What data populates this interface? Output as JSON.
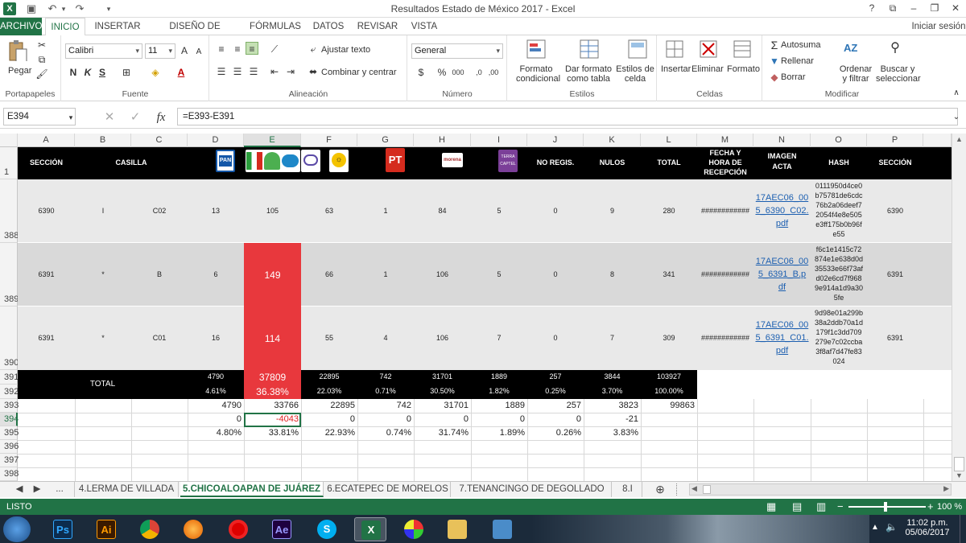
{
  "title": "Resultados Estado de México 2017 - Excel",
  "tabs": {
    "file": "ARCHIVO",
    "items": [
      "INICIO",
      "INSERTAR",
      "DISEÑO DE PÁGINA",
      "FÓRMULAS",
      "DATOS",
      "REVISAR",
      "VISTA"
    ],
    "signin": "Iniciar sesión"
  },
  "ribbon": {
    "paste": "Pegar",
    "clipboard": "Portapapeles",
    "font_name": "Calibri",
    "font_size": "11",
    "font_group": "Fuente",
    "wrap": "Ajustar texto",
    "merge": "Combinar y centrar",
    "align_group": "Alineación",
    "number_format": "General",
    "number_group": "Número",
    "cond_format": [
      "Formato",
      "condicional"
    ],
    "as_table": [
      "Dar formato",
      "como tabla"
    ],
    "cell_styles": [
      "Estilos de",
      "celda"
    ],
    "styles_group": "Estilos",
    "insert": "Insertar",
    "delete": "Eliminar",
    "format": "Formato",
    "cells_group": "Celdas",
    "autosum": "Autosuma",
    "fill": "Rellenar",
    "clear": "Borrar",
    "sort": [
      "Ordenar",
      "y filtrar"
    ],
    "find": [
      "Buscar y",
      "seleccionar"
    ],
    "modify_group": "Modificar"
  },
  "formula_bar": {
    "cell_ref": "E394",
    "fx": "fx",
    "formula": "=E393-E391"
  },
  "columns": [
    "A",
    "B",
    "C",
    "D",
    "E",
    "F",
    "G",
    "H",
    "I",
    "J",
    "K",
    "L",
    "M",
    "N",
    "O",
    "P"
  ],
  "header_row": {
    "row": "1",
    "seccion": "SECCIÓN",
    "casilla": "CASILLA",
    "no_regis": "NO REGIS.",
    "nulos": "NULOS",
    "total": "TOTAL",
    "fecha": [
      "FECHA Y",
      "HORA DE",
      "RECEPCIÓN"
    ],
    "imagen": [
      "IMAGEN",
      "ACTA"
    ],
    "hash": "HASH",
    "seccion2": "SECCIÓN",
    "logos": {
      "pan": "PAN",
      "pt": "PT",
      "morena": "morena",
      "pri": "PRI",
      "prd": "PRD",
      "terra": "TERRA CAPTEL"
    }
  },
  "rows": [
    {
      "row": "388",
      "a": "6390",
      "b": "I",
      "c": "C02",
      "d": "13",
      "e": "105",
      "f": "63",
      "g": "1",
      "h": "84",
      "i": "5",
      "j": "0",
      "k": "9",
      "l": "280",
      "m": "############",
      "n": [
        "17AEC06_00",
        "5_6390_C02.",
        "pdf"
      ],
      "o": [
        "0111950d4ce0",
        "b75781de6cdc",
        "76b2a06deef7",
        "2054f4e8e505",
        "e3ff175b0b96f",
        "e55"
      ],
      "p": "6390"
    },
    {
      "row": "389",
      "a": "6391",
      "b": "*",
      "c": "B",
      "d": "6",
      "e": "149",
      "f": "66",
      "g": "1",
      "h": "106",
      "i": "5",
      "j": "0",
      "k": "8",
      "l": "341",
      "m": "############",
      "n": [
        "17AEC06_00",
        "5_6391_B.p",
        "df"
      ],
      "o": [
        "f6c1e1415c72",
        "874e1e638d0d",
        "35533e66f73af",
        "d02e6cd7f968",
        "9e914a1d9a30",
        "5fe"
      ],
      "p": "6391"
    },
    {
      "row": "390",
      "a": "6391",
      "b": "*",
      "c": "C01",
      "d": "16",
      "e": "114",
      "f": "55",
      "g": "4",
      "h": "106",
      "i": "7",
      "j": "0",
      "k": "7",
      "l": "309",
      "m": "############",
      "n": [
        "17AEC06_00",
        "5_6391_C01.",
        "pdf"
      ],
      "o": [
        "9d98e01a299b",
        "38a2ddb70a1d",
        "179f1c3dd709",
        "279e7c02ccba",
        "3f8af7d47fe83",
        "024"
      ],
      "p": "6391"
    }
  ],
  "total": {
    "rows": [
      "391",
      "392"
    ],
    "label": "TOTAL",
    "values": [
      "4790",
      "37809",
      "22895",
      "742",
      "31701",
      "1889",
      "257",
      "3844",
      "103927"
    ],
    "percents": [
      "4.61%",
      "36.38%",
      "22.03%",
      "0.71%",
      "30.50%",
      "1.82%",
      "0.25%",
      "3.70%",
      "100.00%"
    ]
  },
  "row393": {
    "row": "393",
    "values": [
      "4790",
      "33766",
      "22895",
      "742",
      "31701",
      "1889",
      "257",
      "3823",
      "99863"
    ]
  },
  "row394": {
    "row": "394",
    "values": [
      "0",
      "-4043",
      "0",
      "0",
      "0",
      "0",
      "0",
      "-21"
    ]
  },
  "row395": {
    "row": "395",
    "values": [
      "4.80%",
      "33.81%",
      "22.93%",
      "0.74%",
      "31.74%",
      "1.89%",
      "0.26%",
      "3.83%"
    ]
  },
  "empty_rows": [
    "396",
    "397",
    "398"
  ],
  "sheets": {
    "nav_more": "...",
    "items": [
      "4.LERMA DE VILLADA",
      "5.CHICOALOAPAN DE JUÁREZ",
      "6.ECATEPEC DE MORELOS",
      "7.TENANCINGO DE DEGOLLADO",
      "8.I"
    ]
  },
  "status": {
    "mode": "LISTO",
    "zoom": "100 %"
  },
  "taskbar": {
    "time": "11:02 p.m.",
    "date": "05/06/2017",
    "apps": [
      "Ps",
      "Ai",
      "Ae"
    ]
  },
  "colors": {
    "excel_green": "#217346",
    "highlight_red": "#e8383d",
    "band_gray": "#d9d9d9",
    "black": "#000000"
  }
}
